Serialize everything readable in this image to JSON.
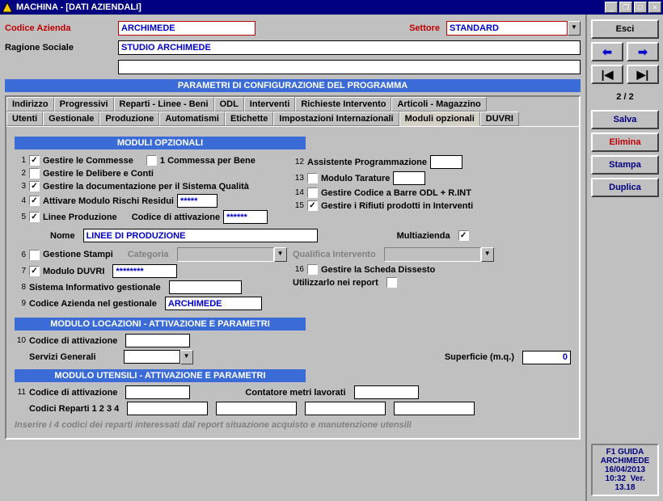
{
  "titlebar": {
    "text": "MACHINA - [DATI AZIENDALI]"
  },
  "header": {
    "codice_label": "Codice Azienda",
    "codice_value": "ARCHIMEDE",
    "settore_label": "Settore",
    "settore_value": "STANDARD",
    "ragione_label": "Ragione Sociale",
    "ragione_value": "STUDIO ARCHIMEDE",
    "extra_value": ""
  },
  "band_main": "PARAMETRI DI CONFIGURAZIONE DEL PROGRAMMA",
  "tabs_row1": [
    "Indirizzo",
    "Progressivi",
    "Reparti - Linee - Beni",
    "ODL",
    "Interventi",
    "Richieste Intervento",
    "Articoli - Magazzino"
  ],
  "tabs_row2": [
    "Utenti",
    "Gestionale",
    "Produzione",
    "Automatismi",
    "Etichette",
    "Impostazioni Internazionali",
    "Moduli opzionali",
    "DUVRI"
  ],
  "active_tab": "Moduli opzionali",
  "sec_moduli": "MODULI OPZIONALI",
  "opts": {
    "r1": {
      "n": "1",
      "chk": true,
      "label": "Gestire le Commesse",
      "chk2": false,
      "label2": "1 Commessa per Bene",
      "n12": "12",
      "label12": "Assistente Programmazione",
      "v12": ""
    },
    "r2": {
      "n": "2",
      "chk": false,
      "label": "Gestire le Delibere e Conti",
      "n13": "13",
      "chk13": false,
      "label13": "Modulo Tarature",
      "v13": ""
    },
    "r3": {
      "n": "3",
      "chk": true,
      "label": "Gestire la documentazione per il Sistema Qualità",
      "n14": "14",
      "chk14": false,
      "label14": "Gestire Codice a Barre ODL + R.INT"
    },
    "r4": {
      "n": "4",
      "chk": true,
      "label": "Attivare Modulo Rischi Residui",
      "v": "*****",
      "n15": "15",
      "chk15": true,
      "label15": "Gestire i Rifiuti prodotti in Interventi"
    },
    "r5": {
      "n": "5",
      "chk": true,
      "label": "Linee Produzione",
      "cod_label": "Codice di attivazione",
      "cod_v": "******"
    },
    "nome_label": "Nome",
    "nome_v": "LINEE DI PRODUZIONE",
    "multi_label": "Multiazienda",
    "multi_chk": true,
    "r6": {
      "n": "6",
      "chk": false,
      "label": "Gestione Stampi",
      "cat_label": "Categoria",
      "qual_label": "Qualifica Intervento"
    },
    "r7": {
      "n": "7",
      "chk": true,
      "label": "Modulo DUVRI",
      "v": "********",
      "n16": "16",
      "chk16": false,
      "label16": "Gestire la Scheda Dissesto"
    },
    "r8": {
      "n": "8",
      "label": "Sistema Informativo gestionale",
      "v": "",
      "util_label": "Utilizzarlo nei report",
      "util_chk": false
    },
    "r9": {
      "n": "9",
      "label": "Codice Azienda nel gestionale",
      "v": "ARCHIMEDE"
    }
  },
  "sec_loc": "MODULO LOCAZIONI - ATTIVAZIONE E PARAMETRI",
  "loc": {
    "n": "10",
    "label": "Codice di attivazione",
    "v": "",
    "serv_label": "Servizi Generali",
    "sup_label": "Superficie (m.q.)",
    "sup_v": "0"
  },
  "sec_ut": "MODULO UTENSILI - ATTIVAZIONE E PARAMETRI",
  "ut": {
    "n": "11",
    "label": "Codice di attivazione",
    "v": "",
    "cont_label": "Contatore metri lavorati",
    "cont_v": "",
    "rep_label": "Codici Reparti 1 2 3 4",
    "rv1": "",
    "rv2": "",
    "rv3": "",
    "rv4": ""
  },
  "note": "Inserire i 4 codici dei reparti interessati dal report situazione acquisto e manutenzione utensili",
  "sidebar": {
    "esci": "Esci",
    "prev": "←",
    "next": "→",
    "first": "|◀",
    "last": "▶|",
    "counter": "2 / 2",
    "salva": "Salva",
    "elimina": "Elimina",
    "stampa": "Stampa",
    "duplica": "Duplica"
  },
  "footer": {
    "f1": "F1 GUIDA",
    "name": "ARCHIMEDE",
    "date": "16/04/2013",
    "time": "10:32",
    "ver": "Ver. 13.18"
  }
}
